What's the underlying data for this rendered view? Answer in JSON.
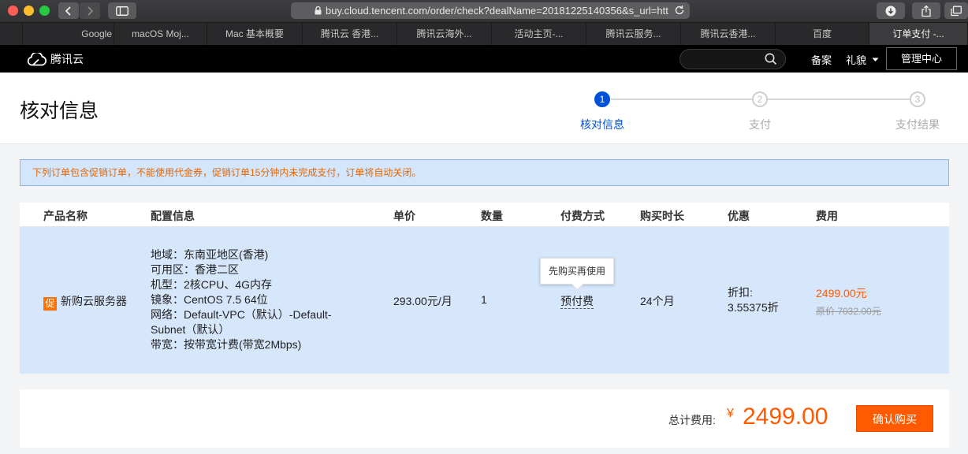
{
  "browser": {
    "url": "buy.cloud.tencent.com/order/check?dealName=20181225140356&s_url=htt",
    "tabs": [
      {
        "label": ""
      },
      {
        "label": "Google"
      },
      {
        "label": "macOS Moj..."
      },
      {
        "label": "Mac 基本概要"
      },
      {
        "label": "腾讯云 香港..."
      },
      {
        "label": "腾讯云海外..."
      },
      {
        "label": "活动主页-..."
      },
      {
        "label": "腾讯云服务..."
      },
      {
        "label": "腾讯云香港..."
      },
      {
        "label": "百度"
      },
      {
        "label": "订单支付 -..."
      }
    ]
  },
  "site_header": {
    "logo_text": "腾讯云",
    "beian": "备案",
    "user": "礼貌",
    "console": "管理中心"
  },
  "page": {
    "title": "核对信息",
    "steps": [
      {
        "num": "1",
        "label": "核对信息"
      },
      {
        "num": "2",
        "label": "支付"
      },
      {
        "num": "3",
        "label": "支付结果"
      }
    ]
  },
  "notice": "下列订单包含促销订单，不能使用代金券，促销订单15分钟内未完成支付，订单将自动关闭。",
  "table": {
    "headers": {
      "product": "产品名称",
      "config": "配置信息",
      "price": "单价",
      "qty": "数量",
      "pay": "付费方式",
      "duration": "购买时长",
      "discount": "优惠",
      "fee": "费用"
    },
    "row": {
      "promo_tag": "促",
      "product": "新购云服务器",
      "config": [
        "地域：东南亚地区(香港)",
        "可用区：香港二区",
        "机型：2核CPU、4G内存",
        "镜象：CentOS 7.5 64位",
        "网络：Default-VPC（默认）-Default-",
        "Subnet（默认）",
        "带宽：按带宽计费(带宽2Mbps)"
      ],
      "price": "293.00元/月",
      "qty": "1",
      "pay": "预付费",
      "pay_tooltip": "先购买再使用",
      "duration": "24个月",
      "discount_label": "折扣:",
      "discount_value": "3.55375折",
      "fee": "2499.00元",
      "fee_original": "原价 7032.00元"
    }
  },
  "footer": {
    "total_label": "总计费用:",
    "currency": "¥",
    "total": "2499.00",
    "confirm": "确认购买"
  },
  "colors": {
    "accent": "#0052d9",
    "price": "#ff5a00",
    "notice_bg": "#d4e6fb",
    "row_bg": "#d6e7fc"
  }
}
